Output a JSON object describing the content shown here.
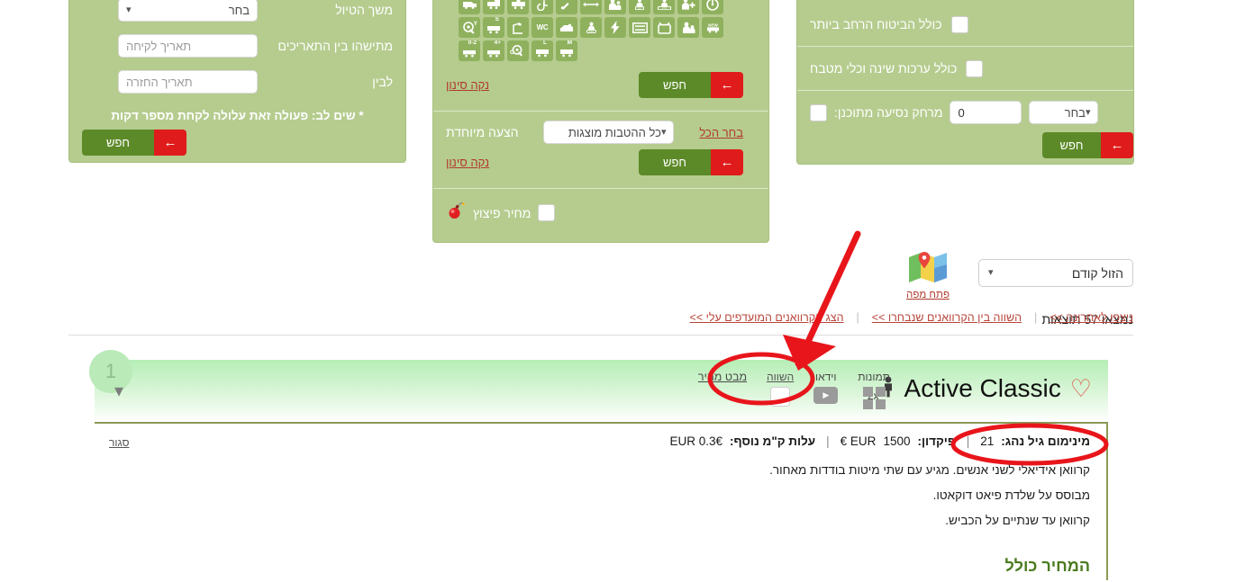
{
  "filters": {
    "left_panel": {
      "name": "trip-duration-filter",
      "rows": [
        {
          "label": "משך הטיול",
          "control": "select",
          "value": "בחר"
        },
        {
          "label": "מתישהו בין התאריכים",
          "control": "date",
          "placeholder": "תאריך לקיחה"
        },
        {
          "label": "לבין",
          "control": "date",
          "placeholder": "תאריך החזרה"
        }
      ],
      "note": "* שים לב: פעולה זאת עלולה לקחת מספר דקות",
      "search_label": "חפש"
    },
    "mid_panel": {
      "icons": [
        "campervan-icon",
        "caravan-trailer-icon",
        "motorhome-icon",
        "wheelchair-icon",
        "automatic-icon",
        "length-icon",
        "family-plus-icon",
        "x3-icon",
        "2plus2-icon",
        "person-plus-icon",
        "aircon-icon",
        "generator-icon",
        "s-size-icon",
        "crane-icon",
        "wc-icon",
        "fridge-icon",
        "4x4-icon",
        "electric-icon",
        "bunk-bed-icon",
        "tv-icon",
        "family-icon",
        "new-icon",
        "age-0-2-icon",
        "plus4-icon",
        "c-license-icon",
        "l-size-icon",
        "m-size-icon"
      ],
      "clear_filter_label": "נקה סינון",
      "search_label": "חפש",
      "special_offer_label": "הצעה מיוחדת",
      "offers_select_value": "כל ההטבות מוצגות",
      "select_all_label": "בחר הכל",
      "clear_filter_label_2": "נקה סינון",
      "search_label_2": "חפש",
      "blast_price_label": "מחיר פיצוץ",
      "blast_price_icon": "bomb-icon"
    },
    "right_panel": {
      "rows": [
        {
          "label": "כולל הביטוח הרחב ביותר",
          "checked": false
        },
        {
          "label": "כולל ערכות שינה וכלי מטבח",
          "checked": false
        },
        {
          "label": "מרחק נסיעה מתוכנן:",
          "checked": false,
          "value": "0",
          "unit_value": "בחר"
        }
      ],
      "search_label": "חפש"
    }
  },
  "toolbar": {
    "sort_value": "הזול קודם",
    "map_label": "פתח מפה",
    "map_icon": "map-icon",
    "results_text": "נמצאו 57 תוצאות"
  },
  "linkbar": {
    "links": [
      "ניצפו לאחרונה >>",
      "השווה בין הקרוואנים שנבחרו >>",
      "הצג הקרוואנים המועדפים עלי >>"
    ]
  },
  "result_card": {
    "badge": "1",
    "name": "Active Classic",
    "favorite_icon": "heart-icon",
    "occupancy_icon": "person-icon",
    "occupancy": "2x",
    "quick_view_label": "מבט מהיר",
    "actions": [
      {
        "label": "השווה",
        "icon": "compare-checkbox-icon"
      },
      {
        "label": "וידאו",
        "icon": "video-icon"
      },
      {
        "label": "תמונות",
        "icon": "gallery-icon"
      }
    ],
    "expand_icon": "chevron-down-icon",
    "specs": {
      "min_age_label": "מינימום גיל נהג:",
      "min_age_value": "21",
      "deposit_label": "פיקדון:",
      "deposit_value": "1500",
      "deposit_currency": "EUR €",
      "extra_km_label": "עלות ק\"מ נוסף:",
      "extra_km_value": "EUR 0.3€"
    },
    "close_label": "סגור",
    "description": [
      "קרוואן אידיאלי לשני אנשים. מגיע עם שתי מיטות בודדות מאחור.",
      "מבוסס על שלדת פיאט דוקאטו.",
      "קרוואן עד שנתיים על הכביש."
    ],
    "total_price_label": "המחיר כולל"
  },
  "annotations": {
    "arrow": "red-arrow-annotation",
    "circle_quick_view": "red-circle-quick-view",
    "circle_min_age": "red-circle-min-age"
  },
  "colors": {
    "panel_green": "#b5cc8e",
    "button_green": "#5c8a28",
    "button_red": "#e01b1b",
    "link_red": "#b23b2e",
    "annotation_red": "#e8151b",
    "price_green": "#4a7a1e"
  }
}
